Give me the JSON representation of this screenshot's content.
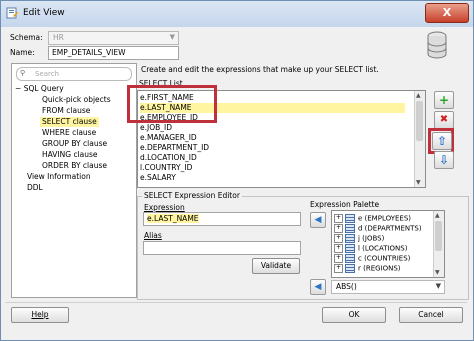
{
  "window": {
    "title": "Edit View",
    "close_label": "X"
  },
  "schema": {
    "label": "Schema:",
    "value": "HR"
  },
  "name": {
    "label": "Name:",
    "value": "EMP_DETAILS_VIEW"
  },
  "search": {
    "placeholder": "Search"
  },
  "nav_tree": [
    {
      "label": "SQL Query",
      "toggle": "−"
    },
    {
      "label": "Quick-pick objects"
    },
    {
      "label": "FROM clause"
    },
    {
      "label": "SELECT clause"
    },
    {
      "label": "WHERE clause"
    },
    {
      "label": "GROUP BY clause"
    },
    {
      "label": "HAVING clause"
    },
    {
      "label": "ORDER BY clause"
    },
    {
      "label": "View Information"
    },
    {
      "label": "DDL"
    }
  ],
  "main": {
    "description": "Create and edit the expressions that make up your SELECT list.",
    "select_list_label": "SELECT List",
    "select_list": [
      "e.FIRST_NAME",
      "e.LAST_NAME",
      "e.EMPLOYEE_ID",
      "e.JOB_ID",
      "e.MANAGER_ID",
      "e.DEPARTMENT_ID",
      "d.LOCATION_ID",
      "l.COUNTRY_ID",
      "e.SALARY"
    ],
    "selected_item": "e.LAST_NAME"
  },
  "side_buttons": {
    "add": "+",
    "remove": "✖",
    "move_up": "⇧",
    "move_down": "⇩"
  },
  "editor": {
    "title": "SELECT Expression Editor",
    "expression_label": "Expression",
    "expression_value": "e.LAST_NAME",
    "alias_label": "Alias",
    "alias_value": "",
    "validate_label": "Validate"
  },
  "palette": {
    "title": "Expression Palette",
    "items": [
      "e (EMPLOYEES)",
      "d (DEPARTMENTS)",
      "j (JOBS)",
      "l (LOCATIONS)",
      "c (COUNTRIES)",
      "r (REGIONS)"
    ],
    "function_value": "ABS()"
  },
  "footer": {
    "help_label": "Help",
    "ok_label": "OK",
    "cancel_label": "Cancel"
  },
  "colors": {
    "selection": "#fff5a0",
    "highlight_box": "#c0303a",
    "titlebar": "#c5d6ec"
  }
}
